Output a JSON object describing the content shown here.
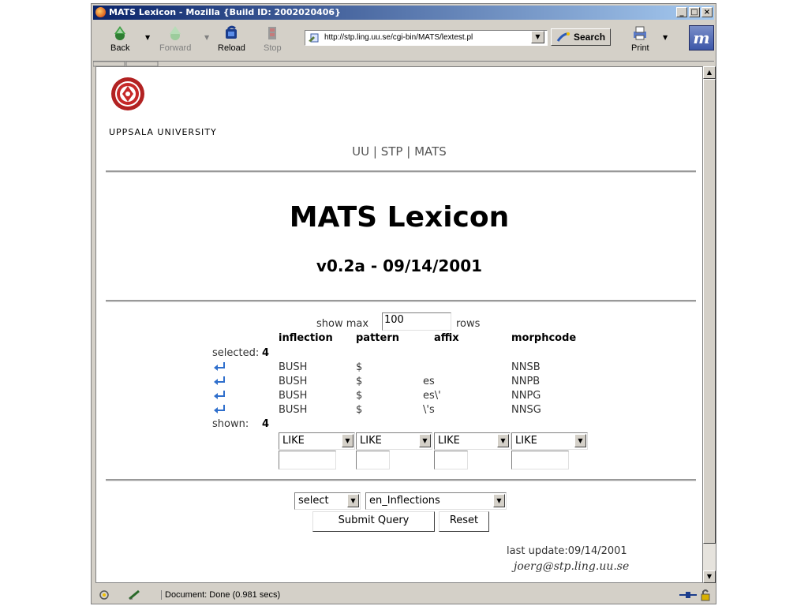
{
  "window": {
    "title": "MATS Lexicon - Mozilla {Build ID: 2002020406}"
  },
  "toolbar": {
    "back": "Back",
    "forward": "Forward",
    "reload": "Reload",
    "stop": "Stop",
    "url": "http://stp.ling.uu.se/cgi-bin/MATS/lextest.pl",
    "search": "Search",
    "print": "Print",
    "throbber": "m"
  },
  "status": {
    "text": "Document: Done (0.981 secs)"
  },
  "page": {
    "university": "UPPSALA UNIVERSITY",
    "nav": {
      "uu": "UU",
      "sep1": "|",
      "stp": "STP",
      "sep2": "|",
      "mats": "MATS"
    },
    "title": "MATS Lexicon",
    "version": "v0.2a - 09/14/2001",
    "show_max_label": "show max",
    "show_max_value": "100",
    "rows_label": "rows",
    "columns": [
      "inflection",
      "pattern",
      "affix",
      "morphcode"
    ],
    "selected_label": "selected:",
    "selected_count": "4",
    "rows": [
      {
        "inflection": "BUSH",
        "pattern": "$",
        "affix": "",
        "morphcode": "NNSB"
      },
      {
        "inflection": "BUSH",
        "pattern": "$",
        "affix": "es",
        "morphcode": "NNPB"
      },
      {
        "inflection": "BUSH",
        "pattern": "$",
        "affix": "es\\'",
        "morphcode": "NNPG"
      },
      {
        "inflection": "BUSH",
        "pattern": "$",
        "affix": "\\'s",
        "morphcode": "NNSG"
      }
    ],
    "shown_label": "shown:",
    "shown_count": "4",
    "filter_ops": [
      "LIKE",
      "LIKE",
      "LIKE",
      "LIKE"
    ],
    "action_select": "select",
    "lexicon_select": "en_Inflections",
    "submit_label": "Submit Query",
    "reset_label": "Reset",
    "last_update": "last update:09/14/2001",
    "email": "joerg@stp.ling.uu.se"
  }
}
